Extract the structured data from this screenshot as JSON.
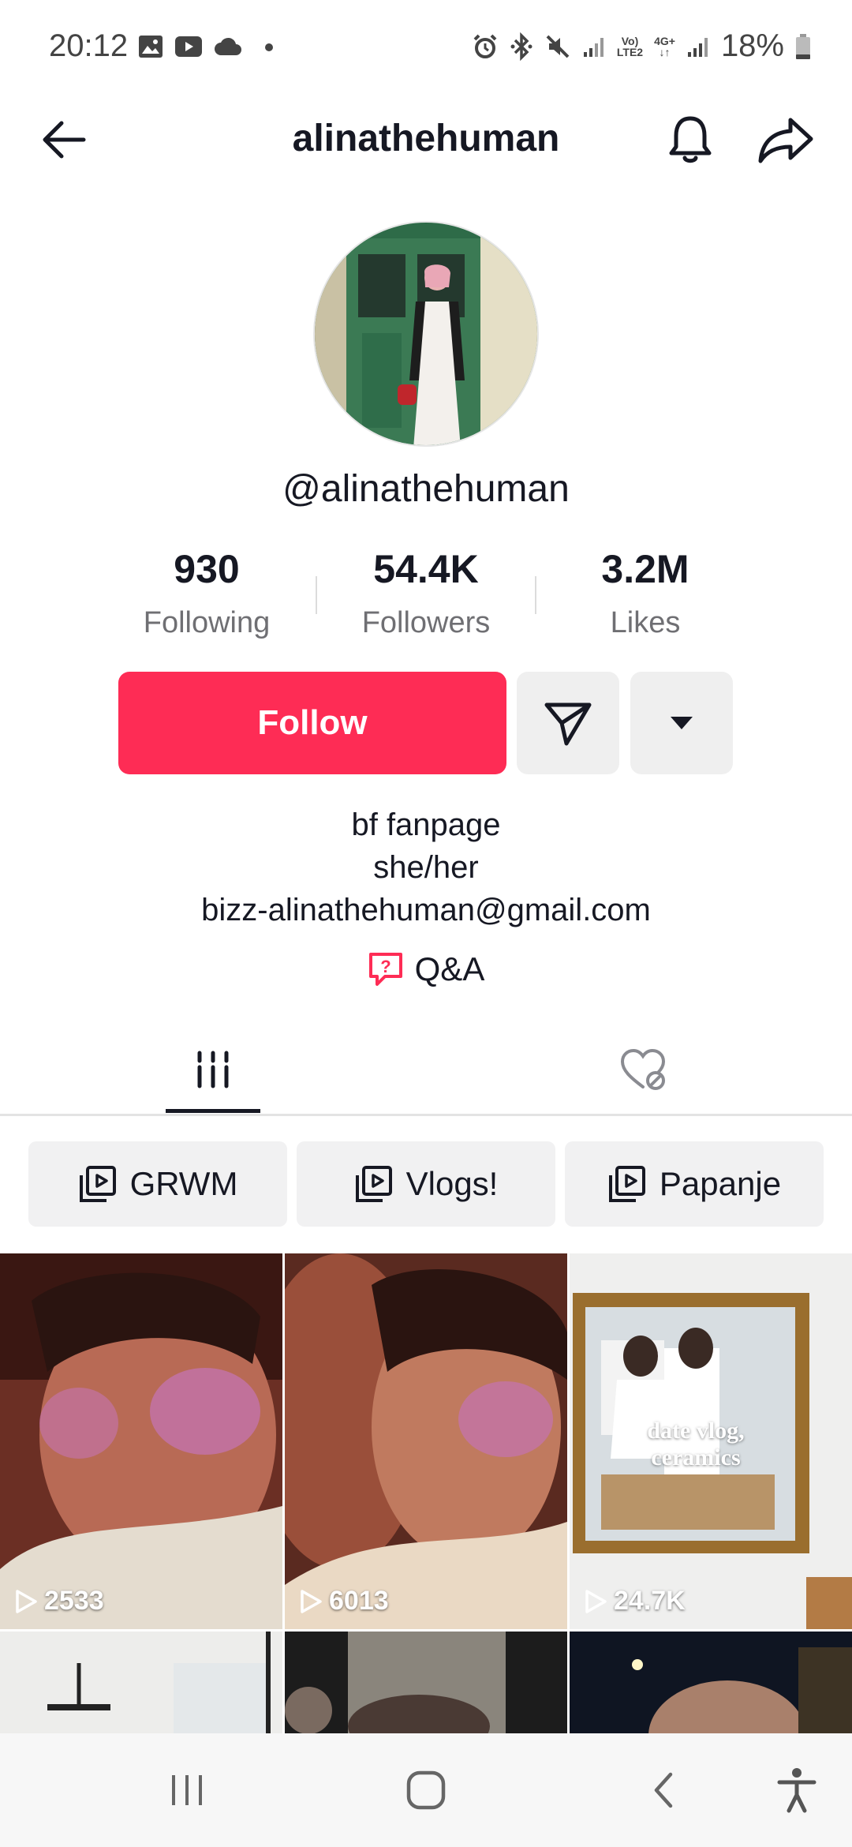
{
  "status_bar": {
    "time": "20:12",
    "battery": "18%",
    "network_top": "Vo)",
    "network_bottom": "LTE2",
    "network2_top": "4G+",
    "network2_bottom": "↓↑"
  },
  "header": {
    "title": "alinathehuman"
  },
  "profile": {
    "handle": "@alinathehuman",
    "stats": [
      {
        "value": "930",
        "label": "Following"
      },
      {
        "value": "54.4K",
        "label": "Followers"
      },
      {
        "value": "3.2M",
        "label": "Likes"
      }
    ],
    "follow_label": "Follow",
    "bio": [
      "bf fanpage",
      "she/her",
      "bizz-alinathehuman@gmail.com"
    ],
    "qa_label": "Q&A"
  },
  "playlists": [
    "GRWM",
    "Vlogs!",
    "Papanje"
  ],
  "videos": [
    {
      "views": "2533"
    },
    {
      "views": "6013"
    },
    {
      "views": "24.7K",
      "overlay_text": "date vlog,\nceramics"
    }
  ],
  "colors": {
    "accent": "#fe2c55",
    "text": "#161823",
    "muted": "#6f6f73",
    "button_gray": "#efefef"
  }
}
